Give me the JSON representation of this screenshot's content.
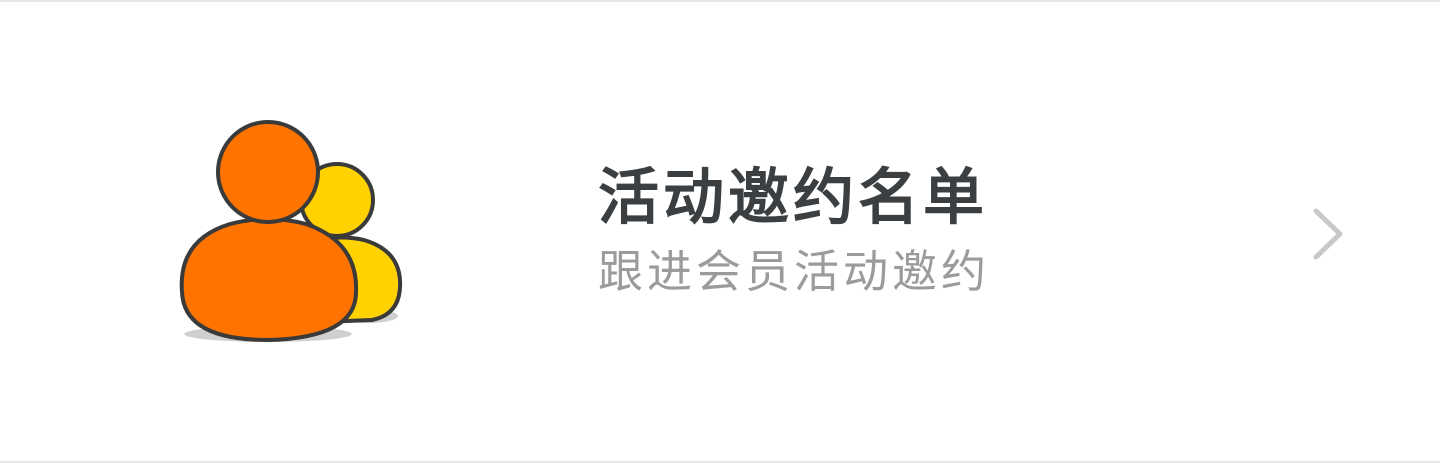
{
  "menu_item": {
    "title": "活动邀约名单",
    "subtitle": "跟进会员活动邀约",
    "icon": "users-icon",
    "chevron_icon": "chevron-right-icon"
  },
  "colors": {
    "primary_person": "#ff7300",
    "secondary_person": "#ffd200",
    "outline": "#3a3a3a",
    "title_text": "#3b3f41",
    "subtitle_text": "#9b9b9b",
    "chevron": "#c8c8c8",
    "divider": "#e6e6e6"
  }
}
